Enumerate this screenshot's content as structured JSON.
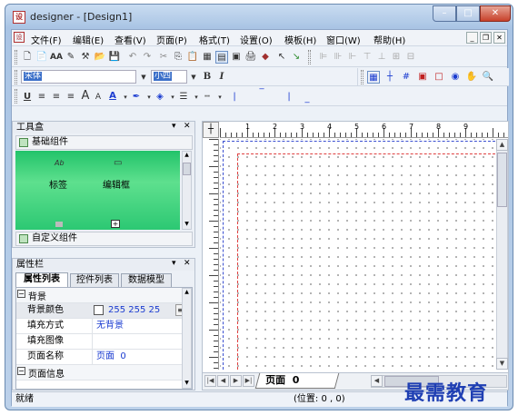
{
  "window": {
    "title": "designer - [Design1]",
    "min": "–",
    "max": "□",
    "close": "✕"
  },
  "menu": [
    "文件(F)",
    "编辑(E)",
    "查看(V)",
    "页面(P)",
    "格式(T)",
    "设置(O)",
    "模板(H)",
    "窗口(W)",
    "帮助(H)"
  ],
  "mdi": {
    "min": "_",
    "restore": "❐",
    "close": "✕"
  },
  "format": {
    "font": "宋体",
    "size": "小四",
    "bold": "B",
    "italic": "I"
  },
  "toolbox": {
    "title": "工具盒",
    "pin": "▾",
    "close": "✕",
    "basic_group": "基础组件",
    "custom_group": "自定义组件",
    "items": [
      {
        "icon": "Ab",
        "label": "标签"
      },
      {
        "icon": "▭",
        "label": "编辑框"
      }
    ]
  },
  "props": {
    "title": "属性栏",
    "tabs": [
      "属性列表",
      "控件列表",
      "数据模型"
    ],
    "section": "背景",
    "rows": [
      {
        "key": "背景颜色",
        "value": "255 255 25"
      },
      {
        "key": "填充方式",
        "value": "无背景"
      },
      {
        "key": "填充图像",
        "value": ""
      },
      {
        "key": "页面名称",
        "value": "页面  0"
      }
    ],
    "section2": "页面信息"
  },
  "ruler": [
    "1",
    "2",
    "3",
    "4",
    "5",
    "6",
    "7",
    "8",
    "9"
  ],
  "page_tab": "页面  0",
  "status": {
    "left": "就绪",
    "pos": "(位置: 0 , 0)"
  },
  "watermark": "最需教育"
}
